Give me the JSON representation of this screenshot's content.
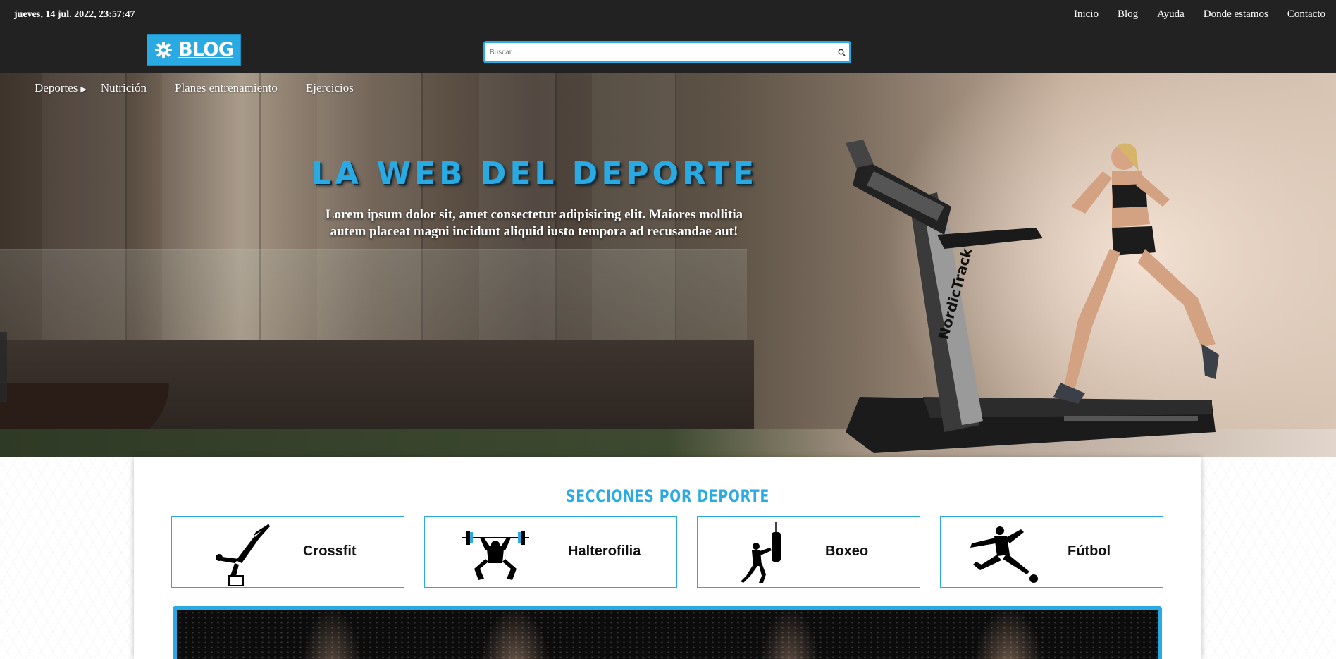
{
  "topbar": {
    "datetime": "jueves, 14 jul. 2022, 23:57:47",
    "nav": [
      "Inicio",
      "Blog",
      "Ayuda",
      "Donde estamos",
      "Contacto"
    ]
  },
  "logo": {
    "text": "BLOG",
    "icon": "gear-icon"
  },
  "search": {
    "placeholder": "Buscar...",
    "value": "",
    "icon": "search-icon"
  },
  "catnav": [
    {
      "label": "Deportes",
      "has_submenu": true
    },
    {
      "label": "Nutrición"
    },
    {
      "label": "Planes entrenamiento"
    },
    {
      "label": "Ejercicios"
    }
  ],
  "hero": {
    "title": "LA WEB DEL DEPORTE",
    "text": "Lorem ipsum dolor sit, amet consectetur adipisicing elit. Maiores mollitia autem placeat magni incidunt aliquid iusto tempora ad recusandae aut!",
    "treadmill_brand": "NordicTrack"
  },
  "sections": {
    "title": "SECCIONES POR DEPORTE",
    "cards": [
      {
        "label": "Crossfit",
        "icon": "crossfit-icon"
      },
      {
        "label": "Halterofilia",
        "icon": "weightlifting-icon"
      },
      {
        "label": "Boxeo",
        "icon": "boxing-icon"
      },
      {
        "label": "Fútbol",
        "icon": "football-icon"
      }
    ]
  },
  "colors": {
    "accent": "#29aae2",
    "topbar": "#222222"
  }
}
